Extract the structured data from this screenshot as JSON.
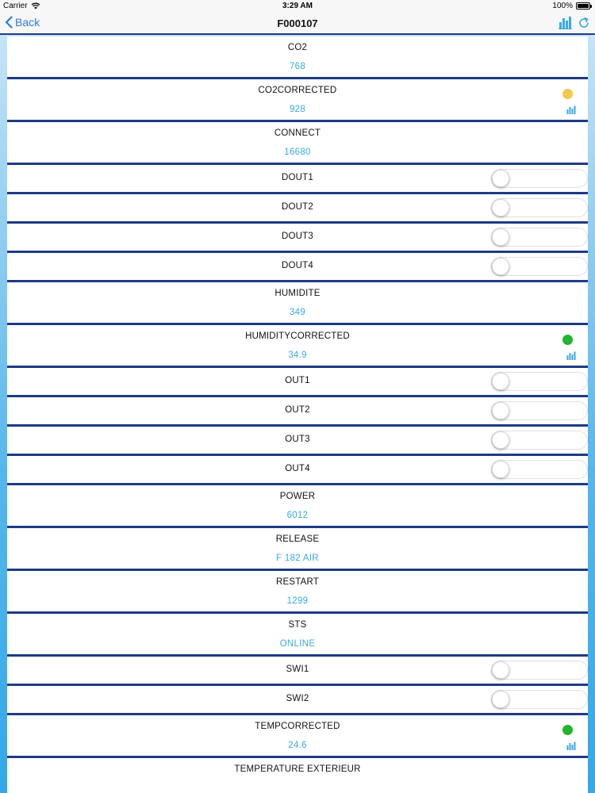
{
  "status_bar": {
    "carrier": "Carrier",
    "time": "3:29 AM",
    "battery": "100%"
  },
  "nav": {
    "back_label": "Back",
    "title": "F000107"
  },
  "colors": {
    "accent": "#2d7ae0",
    "value": "#39a9e4",
    "dot_yellow": "#f6c94c",
    "dot_green": "#20b52a",
    "divider": "#1e3a84"
  },
  "rows": [
    {
      "label": "CO2",
      "value": "768"
    },
    {
      "label": "CO2CORRECTED",
      "value": "928",
      "status": "yellow"
    },
    {
      "label": "CONNECT",
      "value": "16680"
    },
    {
      "label": "DOUT1",
      "toggle": false
    },
    {
      "label": "DOUT2",
      "toggle": false
    },
    {
      "label": "DOUT3",
      "toggle": false
    },
    {
      "label": "DOUT4",
      "toggle": false
    },
    {
      "label": "HUMIDITE",
      "value": "349"
    },
    {
      "label": "HUMIDITYCORRECTED",
      "value": "34.9",
      "status": "green"
    },
    {
      "label": "OUT1",
      "toggle": false
    },
    {
      "label": "OUT2",
      "toggle": false
    },
    {
      "label": "OUT3",
      "toggle": false
    },
    {
      "label": "OUT4",
      "toggle": false
    },
    {
      "label": "POWER",
      "value": "6012"
    },
    {
      "label": "RELEASE",
      "value": "F 182 AIR"
    },
    {
      "label": "RESTART",
      "value": "1299"
    },
    {
      "label": "STS",
      "value": "ONLINE"
    },
    {
      "label": "SWI1",
      "toggle": false
    },
    {
      "label": "SWI2",
      "toggle": false
    },
    {
      "label": "TEMPCORRECTED",
      "value": "24.6",
      "status": "green"
    },
    {
      "label": "TEMPERATURE EXTERIEUR"
    }
  ]
}
